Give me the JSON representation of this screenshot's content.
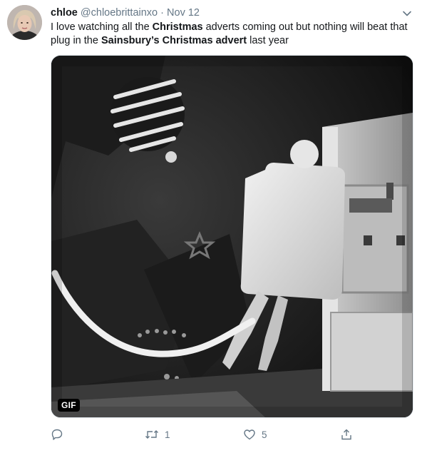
{
  "tweet": {
    "display_name": "chloe",
    "handle": "@chloebrittainxo",
    "separator": "·",
    "date": "Nov 12",
    "text": {
      "part1": "I love watching all the ",
      "bold1": "Christmas",
      "part2": " adverts coming out but nothing will beat that plug in the ",
      "bold2": "Sainsbury’s Christmas advert",
      "part3": " last year"
    },
    "media": {
      "badge": "GIF",
      "type": "gif"
    },
    "actions": {
      "reply_count": "",
      "retweet_count": "1",
      "like_count": "5"
    }
  },
  "icons": {
    "caret": "chevron-down-icon",
    "reply": "reply-icon",
    "retweet": "retweet-icon",
    "like": "heart-icon",
    "share": "share-icon"
  },
  "colors": {
    "text_primary": "#14171a",
    "text_secondary": "#657786",
    "accent": "#1da1f2",
    "border": "#e1e8ed"
  }
}
